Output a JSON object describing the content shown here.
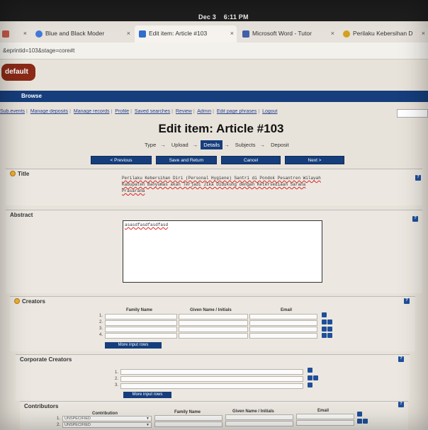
{
  "system": {
    "date": "Dec 3",
    "time": "6:11 PM"
  },
  "tabs": [
    {
      "label": "",
      "icon_color": "#c25a4a",
      "close": "×"
    },
    {
      "label": "Blue and Black Moder",
      "icon_color": "#3f7ad8",
      "close": "×"
    },
    {
      "label": "Edit item: Article #103",
      "icon_color": "#2f6fc9",
      "close": "×"
    },
    {
      "label": "Microsoft Word - Tutor",
      "icon_color": "#3f5fa8",
      "close": "×"
    },
    {
      "label": "Perilaku Kebersihan D",
      "icon_color": "#d4a020",
      "close": "×"
    }
  ],
  "address_text": "&eprintid=103&stage=core#t",
  "default_label": "default",
  "browse_label": "Browse",
  "nav_links": [
    "Sub.events",
    "Manage deposits",
    "Manage records",
    "Profile",
    "Saved searches",
    "Review",
    "Admin",
    "Edit page phrases",
    "Logout"
  ],
  "page_title": "Edit item: Article #103",
  "stages": [
    "Type",
    "Upload",
    "Details",
    "Subjects",
    "Deposit"
  ],
  "current_stage": "Details",
  "buttons": {
    "previous": "< Previous",
    "save": "Save and Return",
    "cancel": "Cancel",
    "next": "Next >"
  },
  "sections": {
    "title": {
      "heading": "Title",
      "value": "Perilaku Kebersihan Diri (Personal Hygiene) Santri di Pondok Pesantren Wilayah Kabupaten Banyumas akan Terjadi Jika Didukung dengan Ketersediaan Sarana Prasarana"
    },
    "abstract": {
      "heading": "Abstract",
      "value": "asasdfasdfasdfasd"
    },
    "creators": {
      "heading": "Creators",
      "cols": [
        "Family Name",
        "Given Name / Initials",
        "Email"
      ],
      "rows": [
        "1.",
        "2.",
        "3.",
        "4."
      ],
      "more": "More input rows"
    },
    "corporate": {
      "heading": "Corporate Creators",
      "rows": [
        "1.",
        "2.",
        "3."
      ],
      "more": "More input rows"
    },
    "contributors": {
      "heading": "Contributors",
      "cols": [
        "Contribution",
        "Family Name",
        "Given Name / Initials",
        "Email"
      ],
      "rows": [
        {
          "num": "1.",
          "contribution": "UNSPECIFIED"
        },
        {
          "num": "2.",
          "contribution": "UNSPECIFIED"
        }
      ]
    }
  },
  "help_glyph": "?",
  "colors": {
    "accent": "#163e7c",
    "default_button": "#8b2a17",
    "optional_marker": "#f4b12e"
  }
}
